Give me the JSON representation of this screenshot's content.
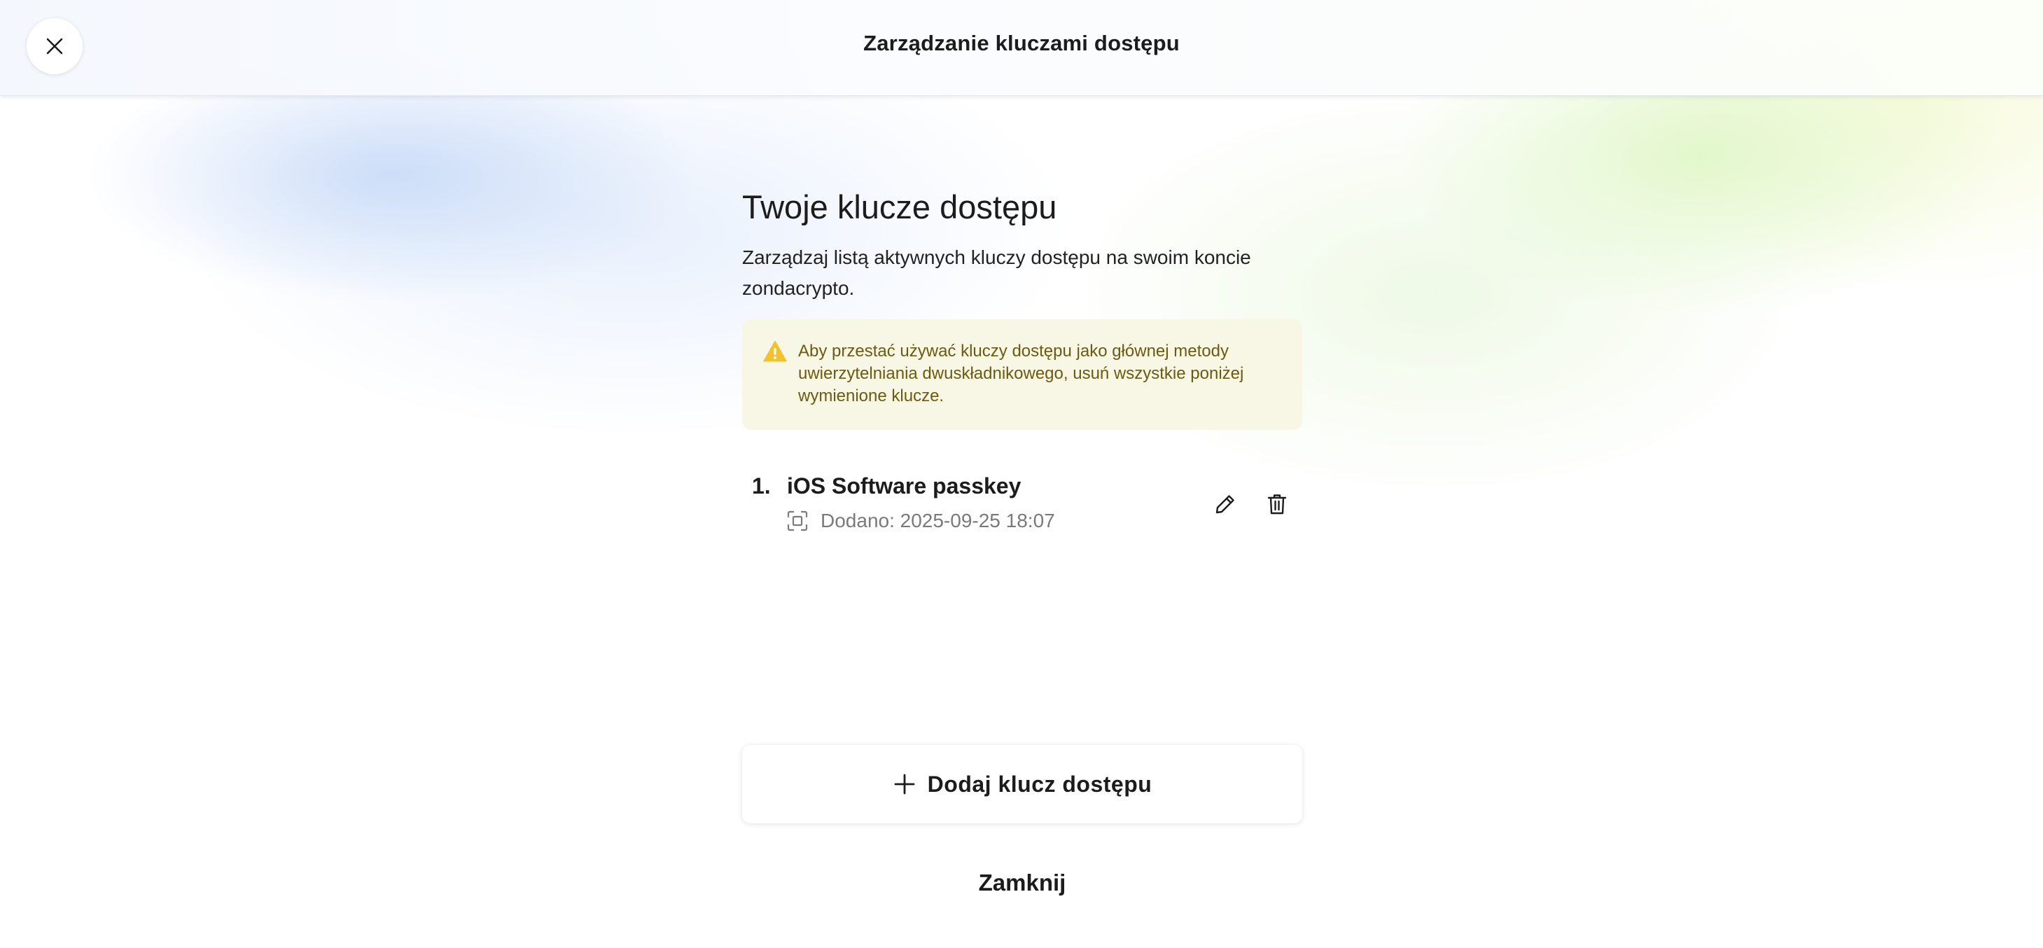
{
  "header": {
    "title": "Zarządzanie kluczami dostępu",
    "close_icon": "close-icon"
  },
  "main": {
    "title": "Twoje klucze dostępu",
    "description": "Zarządzaj listą aktywnych kluczy dostępu na swoim koncie zondacrypto.",
    "alert": {
      "icon": "warning-icon",
      "color": "#f2c12e",
      "text": "Aby przestać używać kluczy dostępu jako głównej metody uwierzytelniania dwuskładnikowego, usuń wszystkie poniżej wymienione klucze."
    },
    "passkeys": [
      {
        "number": "1.",
        "name": "iOS Software passkey",
        "added": "Dodano: 2025-09-25 18:07",
        "meta_icon": "face-id-icon",
        "actions": [
          "edit-icon",
          "trash-icon"
        ]
      }
    ],
    "add_button": {
      "icon": "plus-icon",
      "label": "Dodaj klucz dostępu"
    },
    "close_label": "Zamknij"
  }
}
